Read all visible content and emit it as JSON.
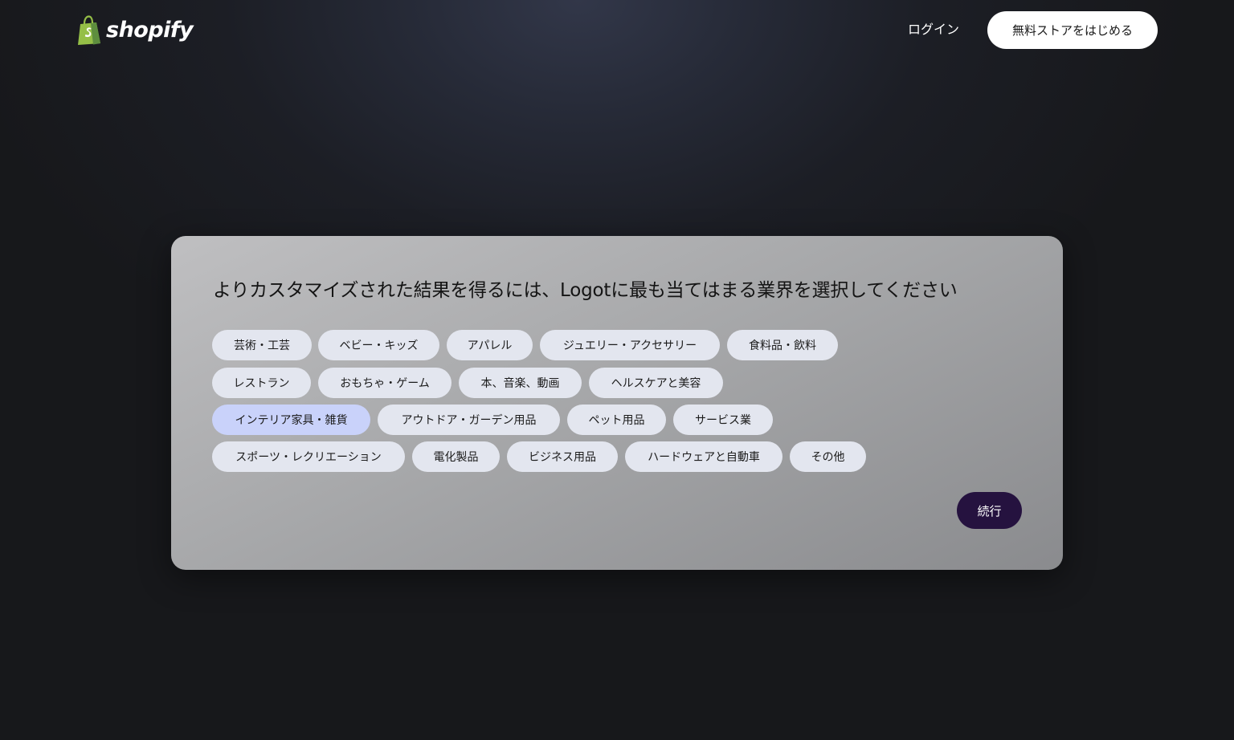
{
  "header": {
    "brand": "shopify",
    "login_label": "ログイン",
    "start_button_label": "無料ストアをはじめる",
    "brand_color": "#95bf47"
  },
  "card": {
    "title": "よりカスタマイズされた結果を得るには、Logotに最も当てはまる業界を選択してください",
    "industries": [
      {
        "label": "芸術・工芸",
        "selected": false
      },
      {
        "label": "ベビー・キッズ",
        "selected": false
      },
      {
        "label": "アパレル",
        "selected": false
      },
      {
        "label": "ジュエリー・アクセサリー",
        "selected": false
      },
      {
        "label": "食料品・飲料",
        "selected": false
      },
      {
        "label": "レストラン",
        "selected": false
      },
      {
        "label": "おもちゃ・ゲーム",
        "selected": false
      },
      {
        "label": "本、音楽、動画",
        "selected": false
      },
      {
        "label": "ヘルスケアと美容",
        "selected": false
      },
      {
        "label": "インテリア家具・雑貨",
        "selected": true
      },
      {
        "label": "アウトドア・ガーデン用品",
        "selected": false
      },
      {
        "label": "ペット用品",
        "selected": false
      },
      {
        "label": "サービス業",
        "selected": false
      },
      {
        "label": "スポーツ・レクリエーション",
        "selected": false
      },
      {
        "label": "電化製品",
        "selected": false
      },
      {
        "label": "ビジネス用品",
        "selected": false
      },
      {
        "label": "ハードウェアと自動車",
        "selected": false
      },
      {
        "label": "その他",
        "selected": false
      }
    ],
    "continue_label": "続行",
    "chip_color": "#e3e6ef",
    "chip_selected_color": "#c9d2fa",
    "continue_color": "#25123f"
  }
}
